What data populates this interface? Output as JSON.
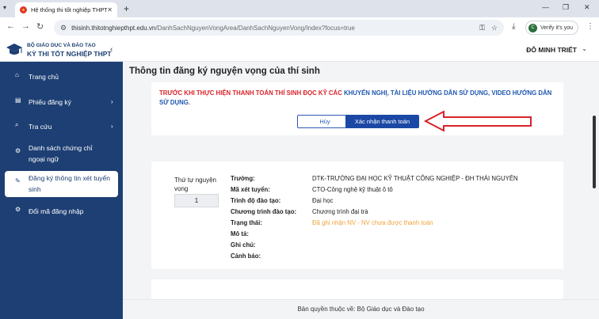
{
  "browser": {
    "tab_title": "Hệ thống thi tốt nghiệp THPT",
    "url_host": "thisinh.thitotnghiepthpt.edu.vn",
    "url_path": "/DanhSachNguyenVongArea/DanhSachNguyenVong/Index?focus=true",
    "profile_label": "Verify it's you",
    "profile_initial": "C"
  },
  "sidebar": {
    "brand_line1": "BỘ GIÁO DỤC VÀ ĐÀO TẠO",
    "brand_line2": "KỲ THI TỐT NGHIỆP THPT",
    "items": [
      {
        "label": "Trang chủ",
        "icon": "home-icon"
      },
      {
        "label": "Phiếu đăng ký",
        "icon": "form-icon"
      },
      {
        "label": "Tra cứu",
        "icon": "search-icon"
      },
      {
        "label": "Danh sách chứng chỉ ngoại ngữ",
        "icon": "gear-icon"
      },
      {
        "label": "Đăng ký thông tin xét tuyển sinh",
        "icon": "edit-icon"
      },
      {
        "label": "Đổi mã đăng nhập",
        "icon": "gear-icon"
      }
    ]
  },
  "header": {
    "user_name": "ĐỖ MINH TRIẾT"
  },
  "page": {
    "title": "Thông tin đăng ký nguyện vọng của thí sinh",
    "warning_red": "TRƯỚC KHI THỰC HIỆN THANH TOÁN THÍ SINH ĐỌC KỸ CÁC ",
    "warning_blue": "KHUYẾN NGHỊ, TÀI LIỆU HƯỚNG DẪN SỬ DỤNG, VIDEO HƯỚNG DẪN SỬ DỤNG",
    "warning_end": ".",
    "cancel_label": "Hủy",
    "confirm_label": "Xác nhận thanh toán"
  },
  "wish": {
    "order_label": "Thứ tự nguyện vọng",
    "order_value": "1",
    "fields": [
      {
        "label": "Trường:",
        "value": "DTK-TRƯỜNG ĐẠI HỌC KỸ THUẬT CÔNG NGHIỆP - ĐH THÁI NGUYÊN"
      },
      {
        "label": "Mã xét tuyển:",
        "value": "CTO-Công nghệ kỹ thuật ô tô"
      },
      {
        "label": "Trình độ đào tạo:",
        "value": "Đại học"
      },
      {
        "label": "Chương trình đào tạo:",
        "value": "Chương trình đại trà"
      },
      {
        "label": "Trạng thái:",
        "value": "Đã ghi nhận NV - NV chưa được thanh toán"
      },
      {
        "label": "Mô tả:",
        "value": ""
      },
      {
        "label": "Ghi chú:",
        "value": ""
      },
      {
        "label": "Cảnh báo:",
        "value": ""
      }
    ]
  },
  "footer": {
    "copyright": "Bản quyền thuộc về: Bộ Giáo dục và Đào tạo"
  },
  "colors": {
    "sidebar_bg": "#1d3f73",
    "warning_red": "#d8232a",
    "link_blue": "#1f57b0",
    "status_orange": "#f0a23a",
    "annotation_red": "#d8232a"
  }
}
